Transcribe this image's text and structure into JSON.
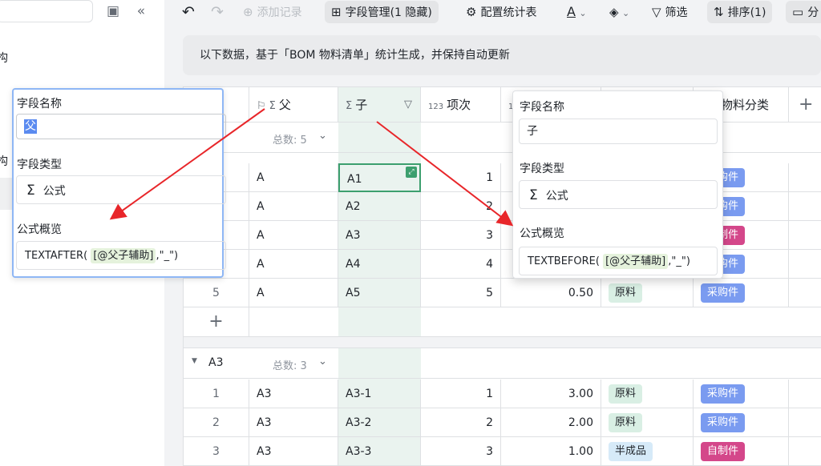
{
  "sidebar": {
    "items": [
      "构",
      "构"
    ],
    "search_value": ""
  },
  "toolbar": {
    "undo_icon": "undo-icon",
    "redo_icon": "redo-icon",
    "add_record": "添加记录",
    "field_manage": "字段管理(1 隐藏)",
    "stats": "配置统计表",
    "text_color_icon": "text-color-icon",
    "fill_color_icon": "fill-color-icon",
    "filter": "筛选",
    "sort": "排序(1)",
    "group": "分"
  },
  "notice": "以下数据，基于「BOM 物料清单」统计生成，并保持自动更新",
  "columns": {
    "parent": "父",
    "child": "子",
    "item_no": "项次",
    "category": "物料分类",
    "add": "+"
  },
  "groups": [
    {
      "summary": "总数: 5",
      "rows": [
        {
          "idx": "",
          "parent": "A",
          "child": "A1",
          "item": "1",
          "qty": "",
          "type": "",
          "cat": "采购件"
        },
        {
          "idx": "",
          "parent": "A",
          "child": "A2",
          "item": "2",
          "qty": "",
          "type": "",
          "cat": "采购件"
        },
        {
          "idx": "",
          "parent": "A",
          "child": "A3",
          "item": "3",
          "qty": "",
          "type": "",
          "cat": "自制件"
        },
        {
          "idx": "",
          "parent": "A",
          "child": "A4",
          "item": "4",
          "qty": "",
          "type": "",
          "cat": "采购件"
        },
        {
          "idx": "5",
          "parent": "A",
          "child": "A5",
          "item": "5",
          "qty": "0.50",
          "type": "原料",
          "cat": "采购件"
        }
      ]
    },
    {
      "name": "A3",
      "summary": "总数: 3",
      "rows": [
        {
          "idx": "1",
          "parent": "A3",
          "child": "A3-1",
          "item": "1",
          "qty": "3.00",
          "type": "原料",
          "cat": "采购件"
        },
        {
          "idx": "2",
          "parent": "A3",
          "child": "A3-2",
          "item": "2",
          "qty": "2.00",
          "type": "原料",
          "cat": "采购件"
        },
        {
          "idx": "3",
          "parent": "A3",
          "child": "A3-3",
          "item": "3",
          "qty": "1.00",
          "type": "半成品",
          "cat": "自制件"
        }
      ]
    }
  ],
  "popup_left": {
    "name_label": "字段名称",
    "name_value": "父",
    "type_label": "字段类型",
    "type_value": "公式",
    "formula_label": "公式概览",
    "formula_fn": "TEXTAFTER(",
    "formula_ref": "[@父子辅助]",
    "formula_rest": ",\"_\")"
  },
  "popup_right": {
    "name_label": "字段名称",
    "name_value": "子",
    "type_label": "字段类型",
    "type_value": "公式",
    "formula_label": "公式概览",
    "formula_fn": "TEXTBEFORE(",
    "formula_ref": "[@父子辅助]",
    "formula_rest": ",\"_\")"
  },
  "colors": {
    "purchase": "#7a9bf0",
    "selfmade": "#d4478a",
    "raw": "#d9efe4",
    "semi": "#d6eaf8",
    "arrow": "#e8262a"
  }
}
